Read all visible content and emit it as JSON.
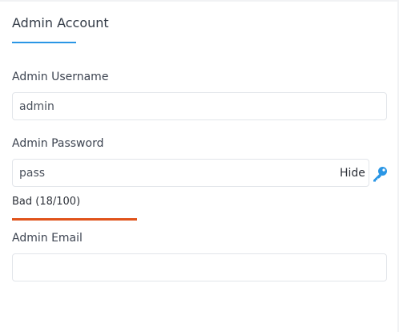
{
  "section": {
    "title": "Admin Account"
  },
  "username": {
    "label": "Admin Username",
    "value": "admin"
  },
  "password": {
    "label": "Admin Password",
    "value": "pass",
    "toggle_label": "Hide",
    "strength_label": "Bad (18/100)",
    "strength_score": 18,
    "strength_color": "#e0531b",
    "icon": "key-icon"
  },
  "email": {
    "label": "Admin Email",
    "value": ""
  },
  "colors": {
    "accent": "#2a96e5",
    "strength_bad": "#e0531b",
    "input_border": "#e2e5ea"
  }
}
